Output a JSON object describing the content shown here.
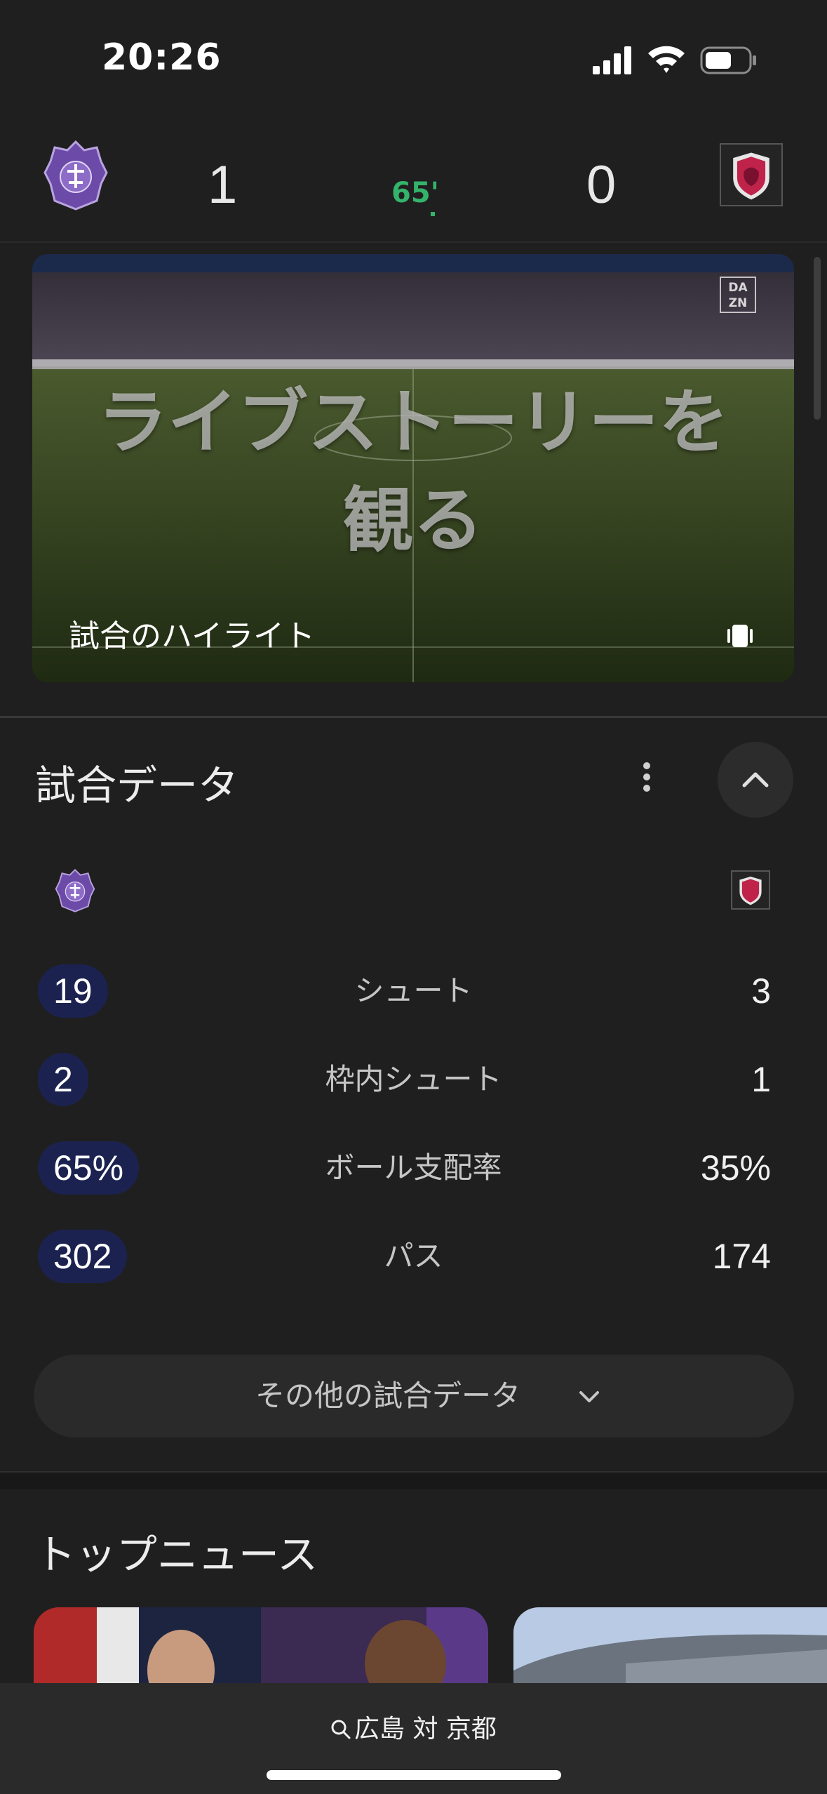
{
  "status_bar": {
    "time": "20:26"
  },
  "score_header": {
    "home_score": "1",
    "away_score": "0",
    "minute": "65'"
  },
  "video": {
    "overlay_title_line1": "ライブストーリーを",
    "overlay_title_line2": "観る",
    "caption": "試合のハイライト",
    "provider_logo_line1": "DA",
    "provider_logo_line2": "ZN"
  },
  "match_data": {
    "title": "試合データ",
    "stats": [
      {
        "home": "19",
        "label": "シュート",
        "away": "3"
      },
      {
        "home": "2",
        "label": "枠内シュート",
        "away": "1"
      },
      {
        "home": "65%",
        "label": "ボール支配率",
        "away": "35%"
      },
      {
        "home": "302",
        "label": "パス",
        "away": "174"
      }
    ],
    "more_button": "その他の試合データ"
  },
  "top_news": {
    "title": "トップニュース"
  },
  "bottom_bar": {
    "search_query": "広島 対 京都"
  },
  "colors": {
    "background": "#1f1f1f",
    "home_stat_pill": "#1c2250",
    "live_minute": "#34b36a",
    "home_team_purple": "#6c4aa8",
    "away_team_red": "#c0234a"
  }
}
